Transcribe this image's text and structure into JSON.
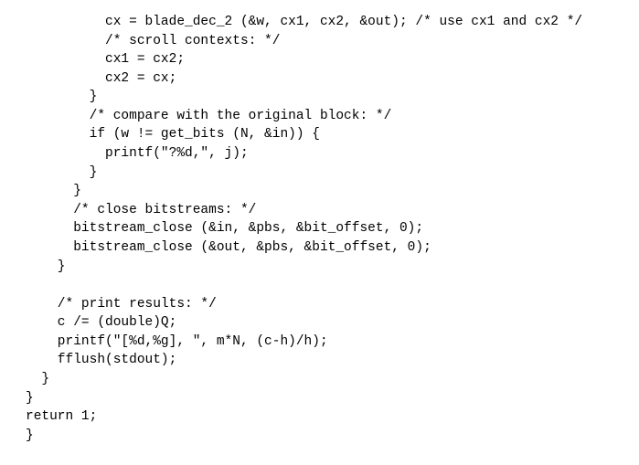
{
  "code": {
    "lines": [
      "          cx = blade_dec_2 (&w, cx1, cx2, &out); /* use cx1 and cx2 */",
      "          /* scroll contexts: */",
      "          cx1 = cx2;",
      "          cx2 = cx;",
      "        }",
      "        /* compare with the original block: */",
      "        if (w != get_bits (N, &in)) {",
      "          printf(\"?%d,\", j);",
      "        }",
      "      }",
      "      /* close bitstreams: */",
      "      bitstream_close (&in, &pbs, &bit_offset, 0);",
      "      bitstream_close (&out, &pbs, &bit_offset, 0);",
      "    }",
      "",
      "    /* print results: */",
      "    c /= (double)Q;",
      "    printf(\"[%d,%g], \", m*N, (c-h)/h);",
      "    fflush(stdout);",
      "  }",
      "}",
      "return 1;"
    ],
    "closing_brace": "}"
  }
}
